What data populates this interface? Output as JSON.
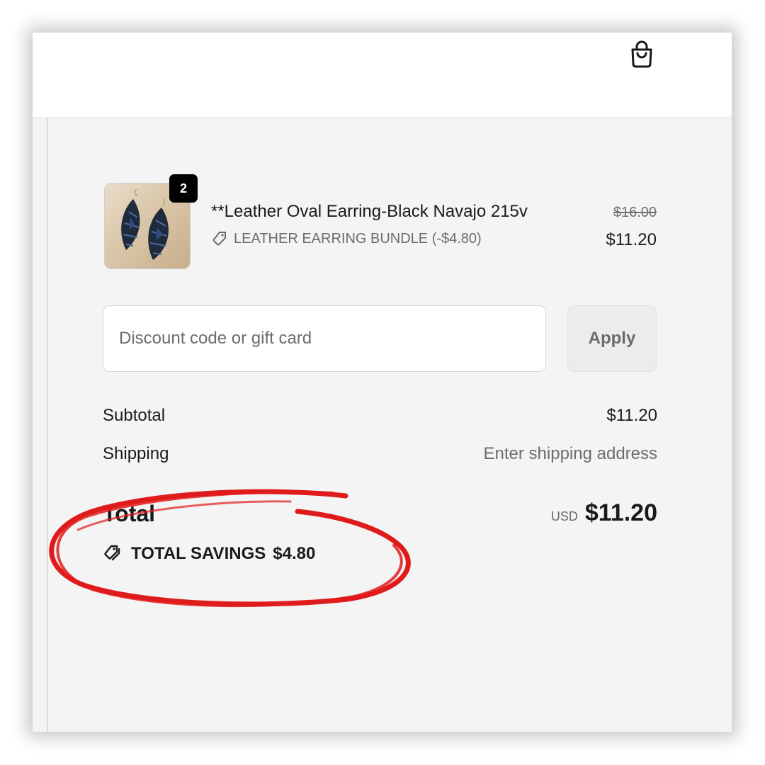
{
  "header": {
    "cart_icon": "shopping-bag-icon"
  },
  "line_item": {
    "quantity": "2",
    "title": "**Leather Oval Earring-Black Navajo 215v",
    "discount_label": "LEATHER EARRING BUNDLE (-$4.80)",
    "discount_icon": "tag-icon",
    "original_price": "$16.00",
    "price": "$11.20"
  },
  "discount": {
    "placeholder": "Discount code or gift card",
    "value": "",
    "apply_label": "Apply"
  },
  "summary": {
    "subtotal_label": "Subtotal",
    "subtotal_value": "$11.20",
    "shipping_label": "Shipping",
    "shipping_value": "Enter shipping address",
    "total_label": "Total",
    "currency": "USD",
    "total_value": "$11.20",
    "savings_icon": "tags-icon",
    "savings_label": "TOTAL SAVINGS",
    "savings_value": "$4.80"
  },
  "annotation": {
    "color": "#e01b1b",
    "shape": "hand-drawn-circle"
  }
}
